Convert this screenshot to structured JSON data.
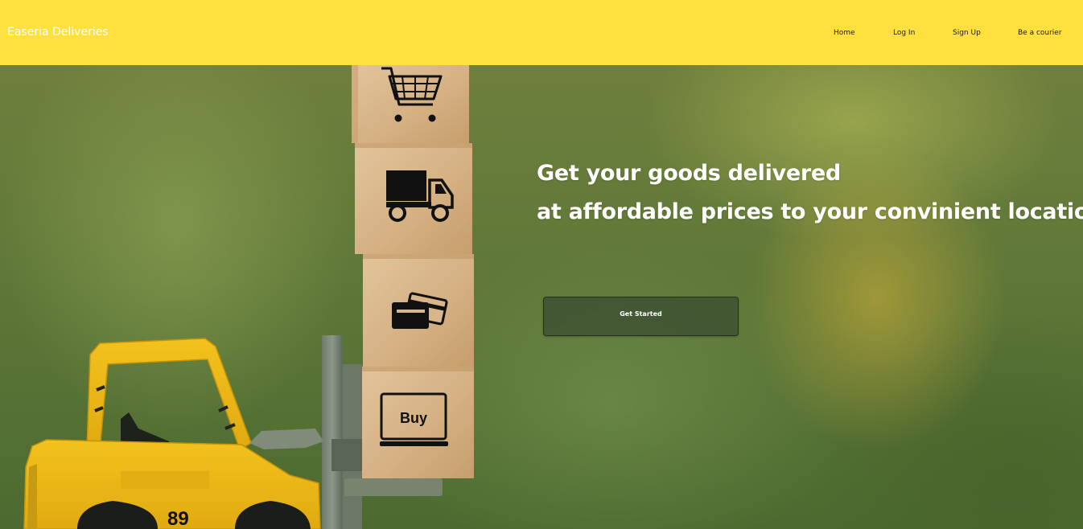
{
  "navbar": {
    "brand": "Easeria Deliveries",
    "background": "#ffe03f",
    "links": [
      {
        "label": "Home"
      },
      {
        "label": "Log In"
      },
      {
        "label": "Sign Up"
      },
      {
        "label": "Be a courier"
      }
    ]
  },
  "hero": {
    "headline_line1": "Get your goods delivered",
    "headline_line2": "at affordable prices to your convinient location.",
    "cta_label": "Get Started",
    "image": {
      "block_icons": [
        "cart-icon",
        "truck-icon",
        "cards-icon",
        "laptop-icon"
      ],
      "laptop_text": "Buy",
      "forklift_number": "89"
    }
  }
}
